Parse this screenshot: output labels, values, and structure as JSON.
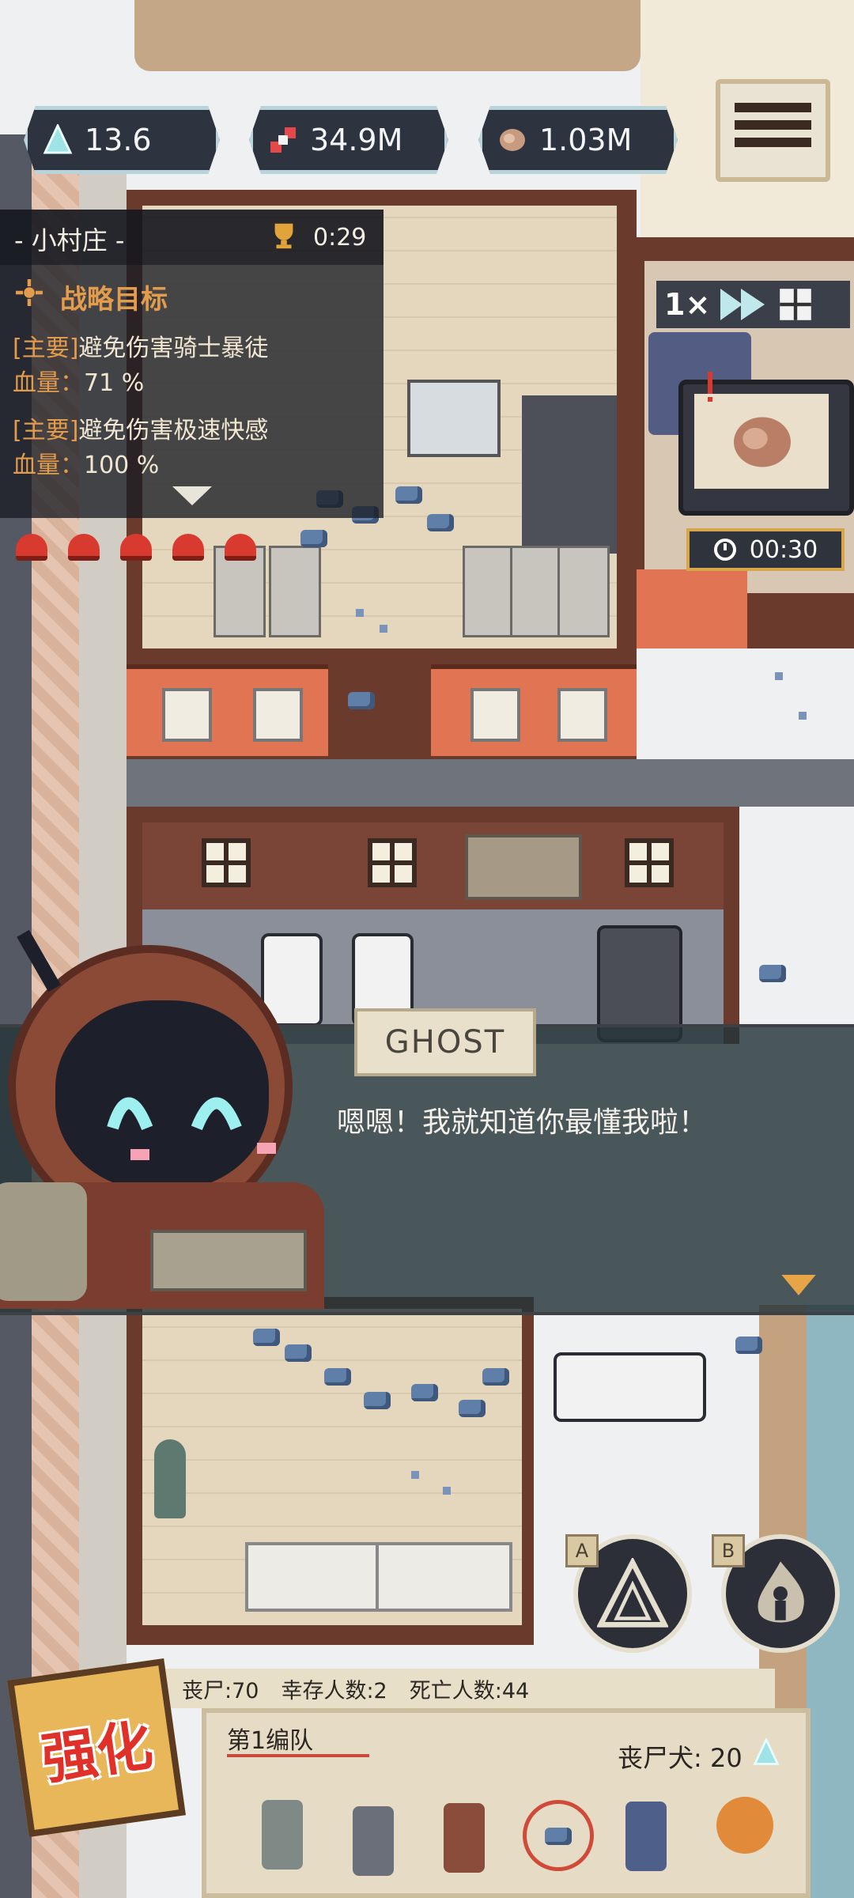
{
  "hud": {
    "resources": [
      {
        "icon": "crystal-icon",
        "value": "13.6"
      },
      {
        "icon": "dna-icon",
        "value": "34.9M"
      },
      {
        "icon": "meat-icon",
        "value": "1.03M"
      }
    ],
    "menu_icon": "hamburger-menu-icon"
  },
  "quest": {
    "location": "- 小村庄 -",
    "timer": "0:29",
    "objectives_title": "战略目标",
    "objectives": [
      {
        "tag": "[主要]",
        "text": "避免伤害骑士暴徒",
        "hp_label": "血量：",
        "hp": "71 %"
      },
      {
        "tag": "[主要]",
        "text": "避免伤害极速快感",
        "hp_label": "血量：",
        "hp": "100 %"
      }
    ],
    "alarm_count": 5
  },
  "speed": {
    "label": "1×"
  },
  "event_timer": "00:30",
  "dialog": {
    "speaker": "GHOST",
    "text": "嗯嗯！我就知道你最懂我啦！"
  },
  "stats": {
    "zombies": "丧尸:70",
    "survivors": "幸存人数:2",
    "dead": "死亡人数:44"
  },
  "team": {
    "name": "第1编队",
    "dog_count": "丧尸犬: 20",
    "units": 6
  },
  "skills": [
    {
      "tag": "A",
      "icon": "triangle-skill-icon"
    },
    {
      "tag": "B",
      "icon": "fire-skill-icon"
    }
  ],
  "upgrade": {
    "label": "强化"
  },
  "colors": {
    "accent": "#e39c4c",
    "alarm": "#d93a2f",
    "hud_border": "#b9d3da"
  }
}
